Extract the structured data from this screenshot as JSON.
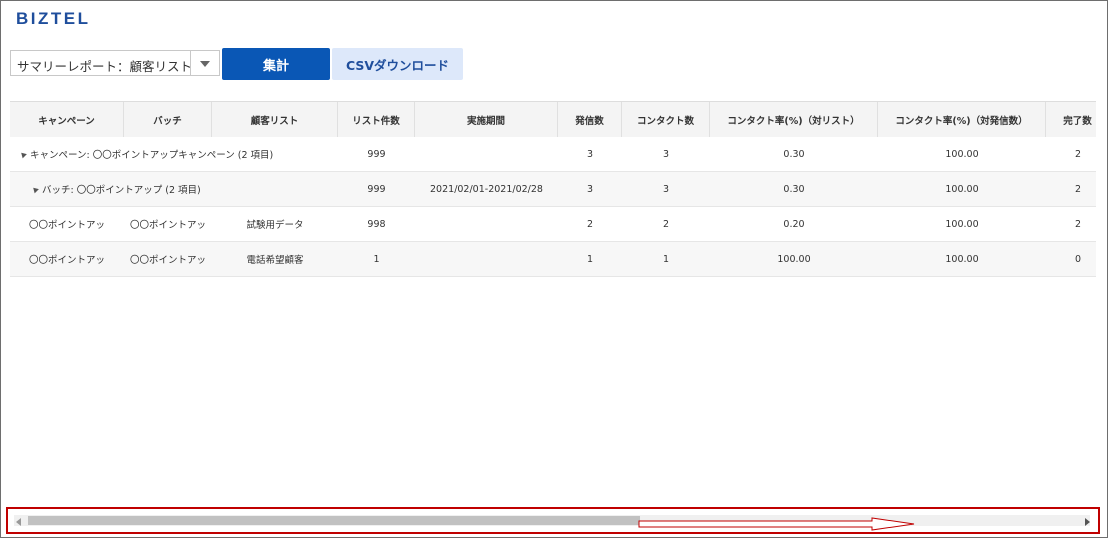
{
  "app": {
    "logo": "BIZTEL"
  },
  "toolbar": {
    "report_select_value": "サマリーレポート：顧客リスト",
    "aggregate_label": "集計",
    "csv_label": "CSVダウンロード"
  },
  "table": {
    "columns": [
      "キャンペーン",
      "バッチ",
      "顧客リスト",
      "リスト件数",
      "実施期間",
      "発信数",
      "コンタクト数",
      "コンタクト率(%)（対リスト）",
      "コンタクト率(%)（対発信数）",
      "完了数"
    ],
    "group_rows": [
      {
        "label": "キャンペーン: 〇〇ポイントアップキャンペーン (2 項目)",
        "list_count": "999",
        "period": "",
        "calls": "3",
        "contacts": "3",
        "rate_list": "0.30",
        "rate_calls": "100.00",
        "done": "2"
      },
      {
        "label": "バッチ: 〇〇ポイントアップ (2 項目)",
        "list_count": "999",
        "period": "2021/02/01-2021/02/28",
        "calls": "3",
        "contacts": "3",
        "rate_list": "0.30",
        "rate_calls": "100.00",
        "done": "2"
      }
    ],
    "detail_rows": [
      {
        "campaign": "〇〇ポイントアッ",
        "batch": "〇〇ポイントアッ",
        "list": "試験用データ",
        "list_count": "998",
        "period": "",
        "calls": "2",
        "contacts": "2",
        "rate_list": "0.20",
        "rate_calls": "100.00",
        "done": "2"
      },
      {
        "campaign": "〇〇ポイントアッ",
        "batch": "〇〇ポイントアッ",
        "list": "電話希望顧客",
        "list_count": "1",
        "period": "",
        "calls": "1",
        "contacts": "1",
        "rate_list": "100.00",
        "rate_calls": "100.00",
        "done": "0"
      }
    ]
  },
  "scrollbar": {
    "position": 0.58,
    "accent": "#c00000"
  },
  "colors": {
    "brand": "#1f4e9c",
    "primary_button": "#0a57b5",
    "secondary_button": "#dde8fa"
  }
}
